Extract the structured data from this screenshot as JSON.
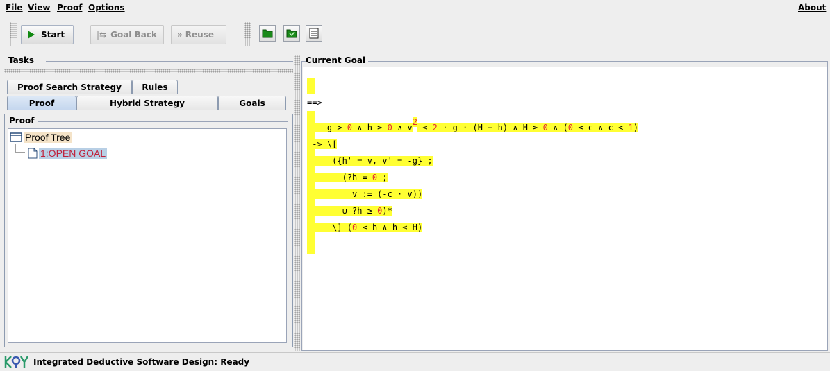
{
  "menu": {
    "file": "File",
    "view": "View",
    "proof": "Proof",
    "options": "Options",
    "about": "About"
  },
  "toolbar": {
    "start_label": "Start",
    "goal_back_label": "Goal Back",
    "reuse_label": "Reuse"
  },
  "left": {
    "tasks_title": "Tasks",
    "tabs_top": [
      "Proof Search Strategy",
      "Rules"
    ],
    "tabs_bottom": [
      "Proof",
      "Hybrid Strategy",
      "Goals"
    ],
    "proof_title": "Proof",
    "tree_root": "Proof Tree",
    "tree_child": "1:OPEN GOAL"
  },
  "right": {
    "title": "Current Goal",
    "sequent_arrow": "==>",
    "lines": {
      "l1a": "    g > ",
      "l1b": "0",
      "l1c": " ∧ h ≥ ",
      "l1d": "0",
      "l1e": " ∧ v",
      "l1sup": "2",
      "l1f": " ≤ ",
      "l1g": "2",
      "l1h": " · g · (H − h) ∧ H ≥ ",
      "l1i": "0",
      "l1j": " ∧ (",
      "l1k": "0",
      "l1l": " ≤ c ∧ c < ",
      "l1m": "1",
      "l1n": ")",
      "l2": " -> \\[",
      "l3": "     ({h' = v, v' = -g} ;",
      "l4a": "       (?h = ",
      "l4b": "0",
      "l4c": " ;",
      "l5": "         v := (-c · v))",
      "l6a": "       ∪ ?h ≥ ",
      "l6b": "0",
      "l6c": ")*",
      "l7a": "     \\] (",
      "l7b": "0",
      "l7c": " ≤ h ∧ h ≤ H)"
    }
  },
  "status": {
    "text": "Integrated Deductive Software Design: Ready"
  },
  "colors": {
    "highlight": "#ffff33",
    "number": "#e23030",
    "tree_selection": "#b8cfe5",
    "tree_root_bg": "#f4e3c8",
    "open_goal_text": "#c0203a"
  }
}
